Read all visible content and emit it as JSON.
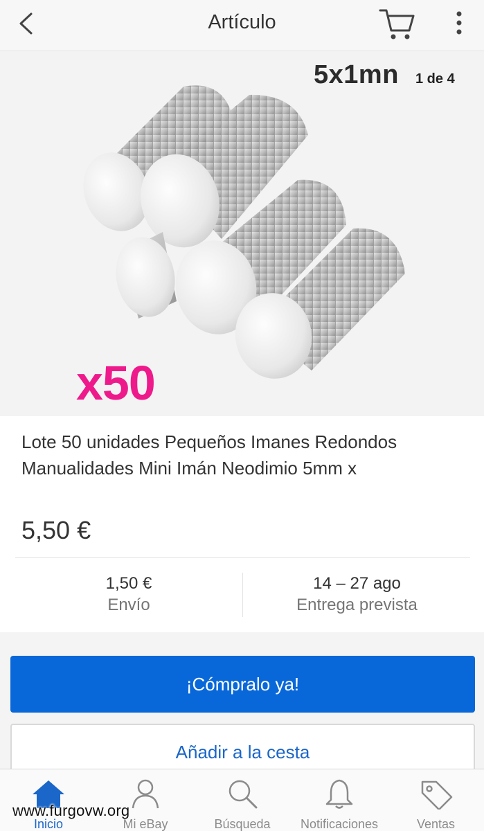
{
  "header": {
    "title": "Artículo",
    "back_icon": "chevron-left-icon",
    "cart_icon": "cart-icon",
    "more_icon": "more-vertical-icon"
  },
  "gallery": {
    "caption": "5x1mn",
    "counter": "1 de 4",
    "quantity_badge": "x50",
    "quantity_color": "#ee1a8c"
  },
  "product": {
    "title": "Lote 50 unidades Pequeños Imanes Redondos Manualidades Mini Imán Neodimio 5mm x",
    "price": "5,50 €"
  },
  "shipping": {
    "cost": "1,50 €",
    "cost_label": "Envío",
    "delivery": "14 – 27 ago",
    "delivery_label": "Entrega prevista"
  },
  "actions": {
    "buy_now": "¡Cómpralo ya!",
    "add_to_cart": "Añadir a la cesta",
    "primary_color": "#0968d9"
  },
  "tabbar": {
    "items": [
      {
        "label": "Inicio",
        "icon": "home-icon",
        "active": true
      },
      {
        "label": "Mi eBay",
        "icon": "user-icon",
        "active": false
      },
      {
        "label": "Búsqueda",
        "icon": "search-icon",
        "active": false
      },
      {
        "label": "Notificaciones",
        "icon": "bell-icon",
        "active": false
      },
      {
        "label": "Ventas",
        "icon": "tag-icon",
        "active": false
      }
    ]
  },
  "watermark": "www.furgovw.org"
}
